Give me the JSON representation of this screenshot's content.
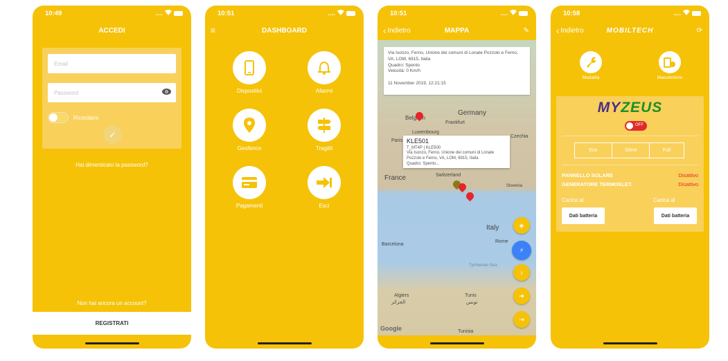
{
  "status": {
    "time1": "10:49",
    "time2": "10:51",
    "time3": "10:51",
    "time4": "10:58",
    "signal": "....",
    "wifi": "ᯤ"
  },
  "login": {
    "title": "ACCEDI",
    "email_placeholder": "Email",
    "password_placeholder": "Password",
    "remember": "Ricordami",
    "forgot": "Hai dimenticato la password?",
    "no_account": "Non hai ancora un account?",
    "register": "REGISTRATI"
  },
  "dashboard": {
    "title": "DASHBOARD",
    "items": [
      {
        "label": "Dispositivi",
        "icon": "phone-icon"
      },
      {
        "label": "Allarmi",
        "icon": "bell-icon"
      },
      {
        "label": "Geofence",
        "icon": "location-pin-icon"
      },
      {
        "label": "Tragitti",
        "icon": "signpost-icon"
      },
      {
        "label": "Pagamenti",
        "icon": "credit-card-icon"
      },
      {
        "label": "Esci",
        "icon": "logout-icon"
      }
    ]
  },
  "map": {
    "back": "Indietro",
    "title": "MAPPA",
    "info_address": "Via Isonzo, Ferno, Unione dei comuni di Lonate Pozzolo e Ferno, VA, LOM, 6915, Italia",
    "info_quadro": "Quadro: Spento",
    "info_speed": "Velocità: 0 Km/h",
    "info_date": "11 November 2019, 12:21:15",
    "callout_title": "KLE501",
    "callout_sub": "T_MT4P | KLE500",
    "callout_address": "Via Isonzo, Ferno, Unione dei comuni di Lonate Pozzolo e Ferno, VA, LOM, 6915, Italia",
    "callout_quadro": "Quadro: Spento...",
    "labels": {
      "germany": "Germany",
      "belgium": "Belgium",
      "frankfurt": "Frankfurt",
      "luxembourg": "Luxembourg",
      "paris": "Paris",
      "czechia": "Czechia",
      "france": "France",
      "switzerland": "Switzerland",
      "slovenia": "Slovenia",
      "italy": "Italy",
      "rome": "Rome",
      "barcelona": "Barcelona",
      "tyrrhenian": "Tyrrhenian Sea",
      "algiers": "Algiers",
      "algiers_ar": "الجزائر",
      "tunis": "Tunis",
      "tunis_ar": "تونس",
      "tunisia": "Tunisia",
      "google": "Google"
    },
    "colors": {
      "pin_red": "#e5252a",
      "pin_olive": "#8a7a1a",
      "fab_blue": "#3b82f6"
    }
  },
  "mobiltech": {
    "back": "Indietro",
    "logo": "MOBILTECH",
    "modes": [
      {
        "label": "Modalità",
        "icon": "wrench-icon"
      },
      {
        "label": "Manutentore",
        "icon": "maintenance-icon"
      }
    ],
    "brand_my": "MY",
    "brand_zeus": "ZEUS",
    "toggle": "OFF",
    "segments": [
      "Eco",
      "Silent",
      "Full"
    ],
    "rows": [
      {
        "label": "PANNELLO SOLARE",
        "value": "Disattivo"
      },
      {
        "label": "GENERATORE TERMOELET.",
        "value": "Disattivo"
      }
    ],
    "carica": "Carica al",
    "dati_batteria": "Dati batteria"
  },
  "colors": {
    "primary": "#F5C208",
    "accent_red": "#e02b2b",
    "brand_green": "#1a8f2a",
    "brand_purple": "#4a2c8c"
  }
}
